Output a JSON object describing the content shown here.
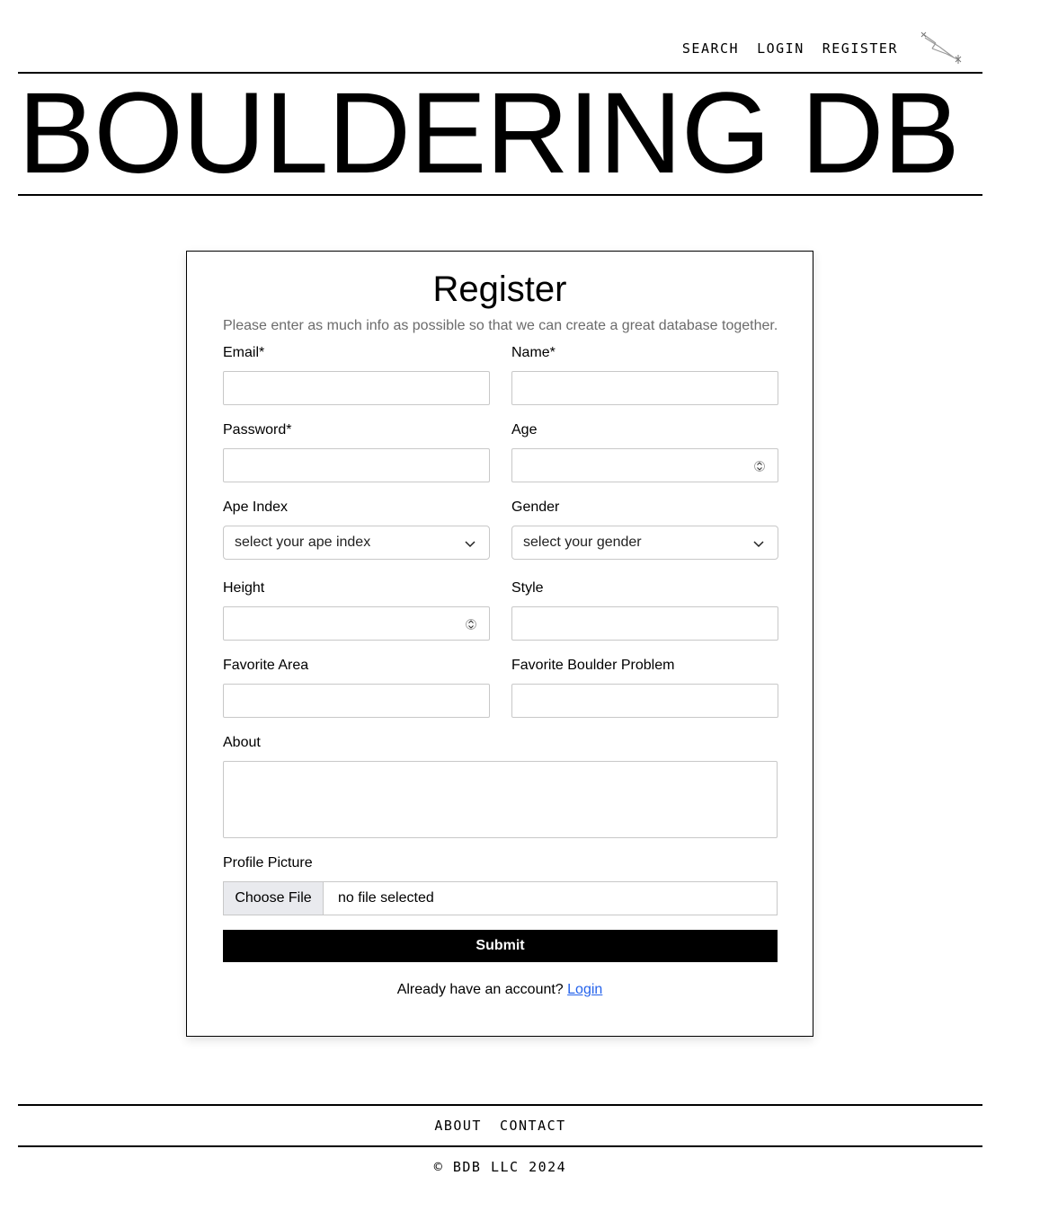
{
  "nav": {
    "search": "SEARCH",
    "login": "LOGIN",
    "register": "REGISTER"
  },
  "brand": "BOULDERING DB",
  "form": {
    "title": "Register",
    "subtitle": "Please enter as much info as possible so that we can create a great database together.",
    "email_label": "Email*",
    "email_value": "",
    "name_label": "Name*",
    "name_value": "",
    "password_label": "Password*",
    "password_value": "",
    "age_label": "Age",
    "age_value": "",
    "ape_label": "Ape Index",
    "ape_selected": "select your ape index",
    "gender_label": "Gender",
    "gender_selected": "select your gender",
    "height_label": "Height",
    "height_value": "",
    "style_label": "Style",
    "style_value": "",
    "area_label": "Favorite Area",
    "area_value": "",
    "problem_label": "Favorite Boulder Problem",
    "problem_value": "",
    "about_label": "About",
    "about_value": "",
    "picture_label": "Profile Picture",
    "choose_file": "Choose File",
    "no_file": "no file selected",
    "submit": "Submit",
    "already": "Already have an account?",
    "login_link": "Login"
  },
  "footer": {
    "about": "ABOUT",
    "contact": "CONTACT",
    "copyright": "© BDB LLC 2024"
  },
  "colors": {
    "link": "#2563eb",
    "subtitle": "#6b6b6b",
    "submit_bg": "#000000",
    "file_button_bg": "#e9eaee"
  },
  "icons": {
    "logo": "constellation-logo-icon",
    "select": "chevron-down-icon",
    "number": "spinner-icon"
  }
}
